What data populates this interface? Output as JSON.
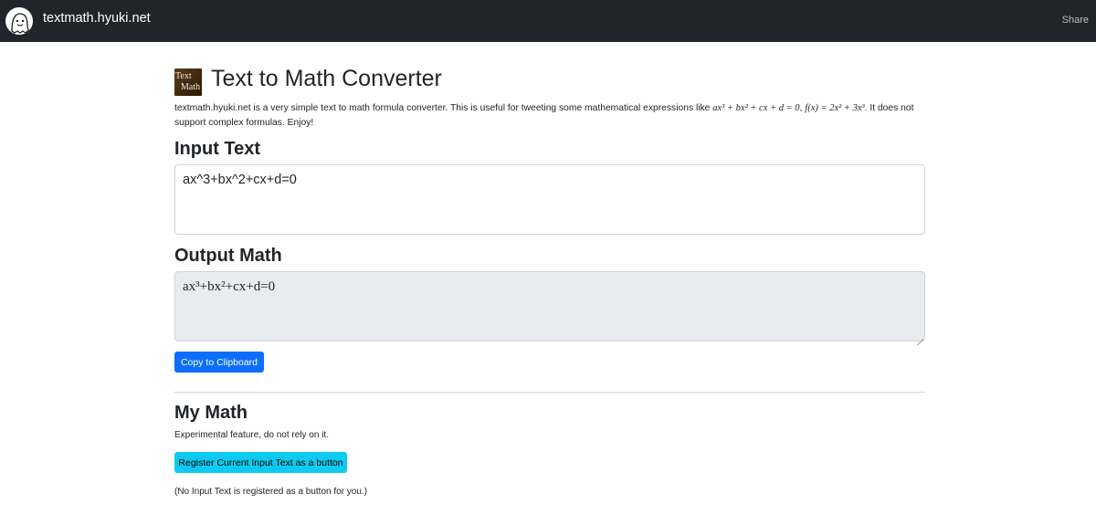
{
  "navbar": {
    "brand": "textmath.hyuki.net",
    "share_label": "Share",
    "logo_icon": "ghost-avatar-icon"
  },
  "header": {
    "logo_line1": "Text",
    "logo_line2": "Math",
    "title": "Text to Math Converter"
  },
  "description": {
    "lead": "textmath.hyuki.net is a very simple text to math formula converter. This is useful for tweeting some mathematical expressions like ",
    "example1": "ax³ + bx² + cx + d = 0",
    "separator": ", ",
    "example2": "f(x) = 2x² + 3x³",
    "tail": ". It does not support complex formulas. Enjoy!"
  },
  "input_section": {
    "heading": "Input Text",
    "value": "ax^3+bx^2+cx+d=0"
  },
  "output_section": {
    "heading": "Output Math",
    "value": "ax³+bx²+cx+d=0",
    "copy_button": "Copy to Clipboard"
  },
  "mymath_section": {
    "heading": "My Math",
    "note": "Experimental feature, do not rely on it.",
    "register_button": "Register Current Input Text as a button",
    "empty_message": "(No Input Text is registered as a button for you.)"
  },
  "colors": {
    "navbar_bg": "#212529",
    "primary": "#0d6efd",
    "info": "#0dcaf0",
    "readonly_bg": "#e9ecef"
  }
}
